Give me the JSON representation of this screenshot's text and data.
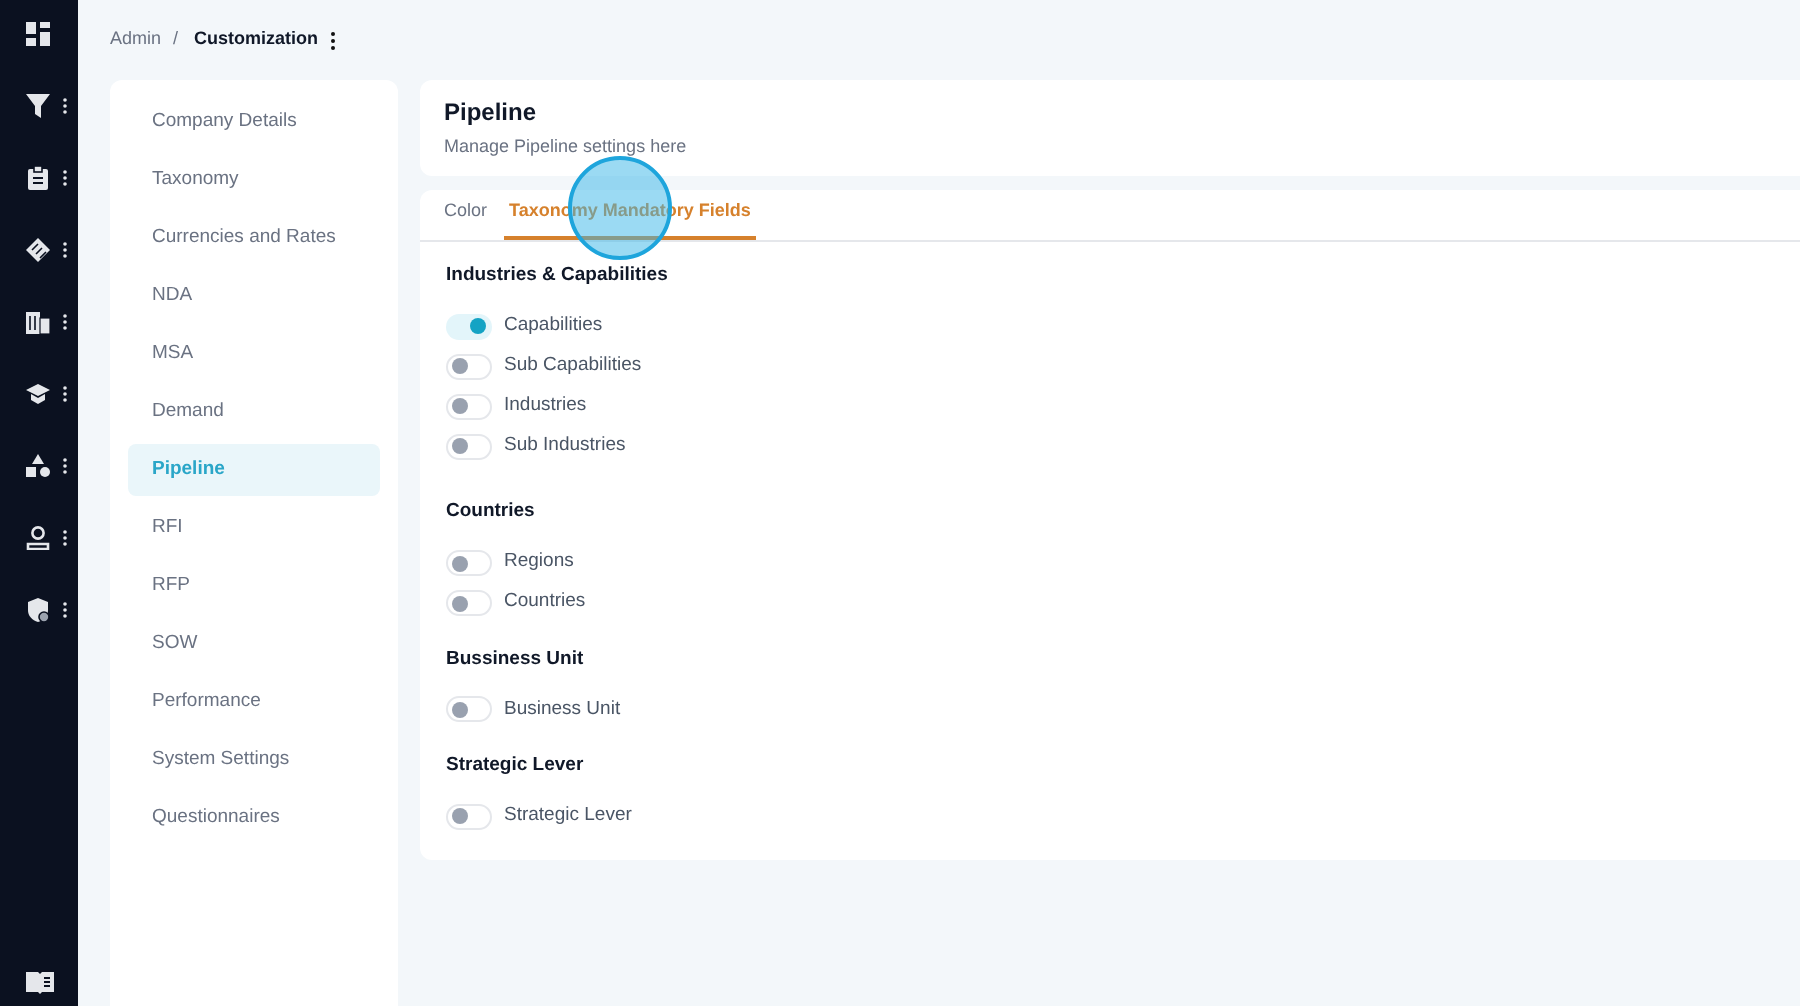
{
  "breadcrumb": {
    "parent": "Admin",
    "separator": "/",
    "current": "Customization"
  },
  "menu": [
    {
      "label": "Company Details",
      "selected": false
    },
    {
      "label": "Taxonomy",
      "selected": false
    },
    {
      "label": "Currencies and Rates",
      "selected": false
    },
    {
      "label": "NDA",
      "selected": false
    },
    {
      "label": "MSA",
      "selected": false
    },
    {
      "label": "Demand",
      "selected": false
    },
    {
      "label": "Pipeline",
      "selected": true
    },
    {
      "label": "RFI",
      "selected": false
    },
    {
      "label": "RFP",
      "selected": false
    },
    {
      "label": "SOW",
      "selected": false
    },
    {
      "label": "Performance",
      "selected": false
    },
    {
      "label": "System Settings",
      "selected": false
    },
    {
      "label": "Questionnaires",
      "selected": false
    }
  ],
  "header": {
    "title": "Pipeline",
    "subtitle": "Manage Pipeline settings here"
  },
  "tabs": [
    {
      "label": "Color",
      "selected": false
    },
    {
      "label": "Taxonomy Mandatory Fields",
      "selected": true
    }
  ],
  "sections": [
    {
      "title": "Industries & Capabilities",
      "toggles": [
        {
          "label": "Capabilities",
          "on": true
        },
        {
          "label": "Sub Capabilities",
          "on": false
        },
        {
          "label": "Industries",
          "on": false
        },
        {
          "label": "Sub Industries",
          "on": false
        }
      ]
    },
    {
      "title": "Countries",
      "toggles": [
        {
          "label": "Regions",
          "on": false
        },
        {
          "label": "Countries",
          "on": false
        }
      ]
    },
    {
      "title": "Bussiness Unit",
      "toggles": [
        {
          "label": "Business Unit",
          "on": false
        }
      ]
    },
    {
      "title": "Strategic Lever",
      "toggles": [
        {
          "label": "Strategic Lever",
          "on": false
        }
      ]
    }
  ]
}
